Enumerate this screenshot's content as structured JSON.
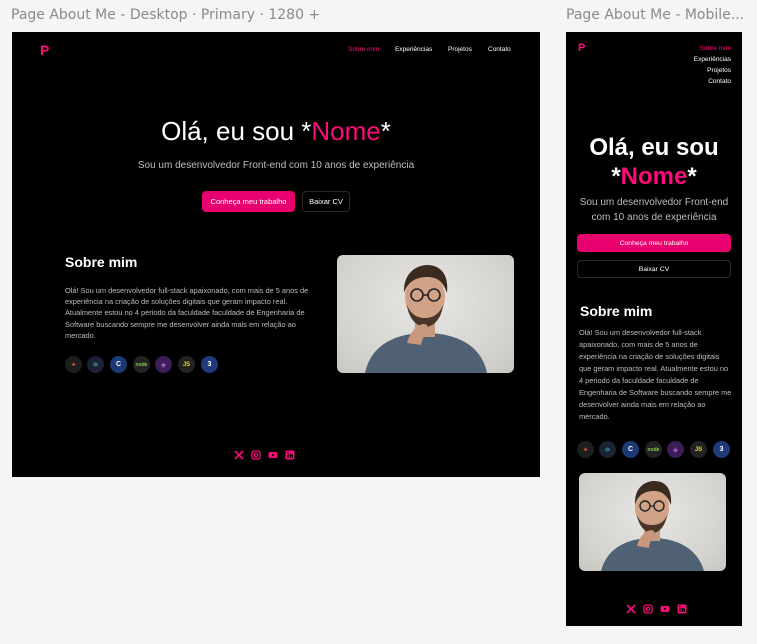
{
  "frames": {
    "desktop_label": "Page About Me - Desktop · Primary · 1280 +",
    "mobile_label": "Page About Me - Mobile..."
  },
  "brand": {
    "logo": "P",
    "accent": "#e8006e"
  },
  "nav": {
    "items": [
      {
        "label": "Sobre mim",
        "active": true
      },
      {
        "label": "Experiências",
        "active": false
      },
      {
        "label": "Projetos",
        "active": false
      },
      {
        "label": "Contato",
        "active": false
      }
    ]
  },
  "hero": {
    "title_prefix": "Olá, eu sou *",
    "title_name": "Nome",
    "title_suffix": "*",
    "mobile_line1": "Olá, eu sou",
    "mobile_star_open": "*",
    "subtitle": "Sou um desenvolvedor Front-end com 10 anos de experiência",
    "primary_button": "Conheça meu trabalho",
    "secondary_button": "Baixar CV"
  },
  "about": {
    "heading": "Sobre mim",
    "body": "Olá! Sou um desenvolvedor full-stack apaixonado, com mais de 5 anos de experiência na criação de soluções digitais que geram impacto real. Atualmente estou no 4 periodo da faculdade faculdade de Engenharia de Software buscando sempre me desenvolver ainda mais em relação ao mercado."
  },
  "tech_icons": [
    {
      "name": "figma-icon",
      "glyph": "✦",
      "bg": "#1e1e1e",
      "color": "#f24e1e"
    },
    {
      "name": "react-icon",
      "glyph": "⚛",
      "bg": "#1a2233",
      "color": "#61dafb"
    },
    {
      "name": "c-lang-icon",
      "glyph": "C",
      "bg": "#1b3a73",
      "color": "#ffffff"
    },
    {
      "name": "nodejs-icon",
      "glyph": "node",
      "bg": "#222222",
      "color": "#8cc84b"
    },
    {
      "name": "graphql-icon",
      "glyph": "◈",
      "bg": "#3a1e55",
      "color": "#b36ae2"
    },
    {
      "name": "javascript-icon",
      "glyph": "JS",
      "bg": "#222222",
      "color": "#f7df1e"
    },
    {
      "name": "css3-icon",
      "glyph": "3",
      "bg": "#1f3a7a",
      "color": "#ffffff"
    }
  ],
  "social_icons": [
    "x-icon",
    "instagram-icon",
    "youtube-icon",
    "linkedin-icon"
  ]
}
